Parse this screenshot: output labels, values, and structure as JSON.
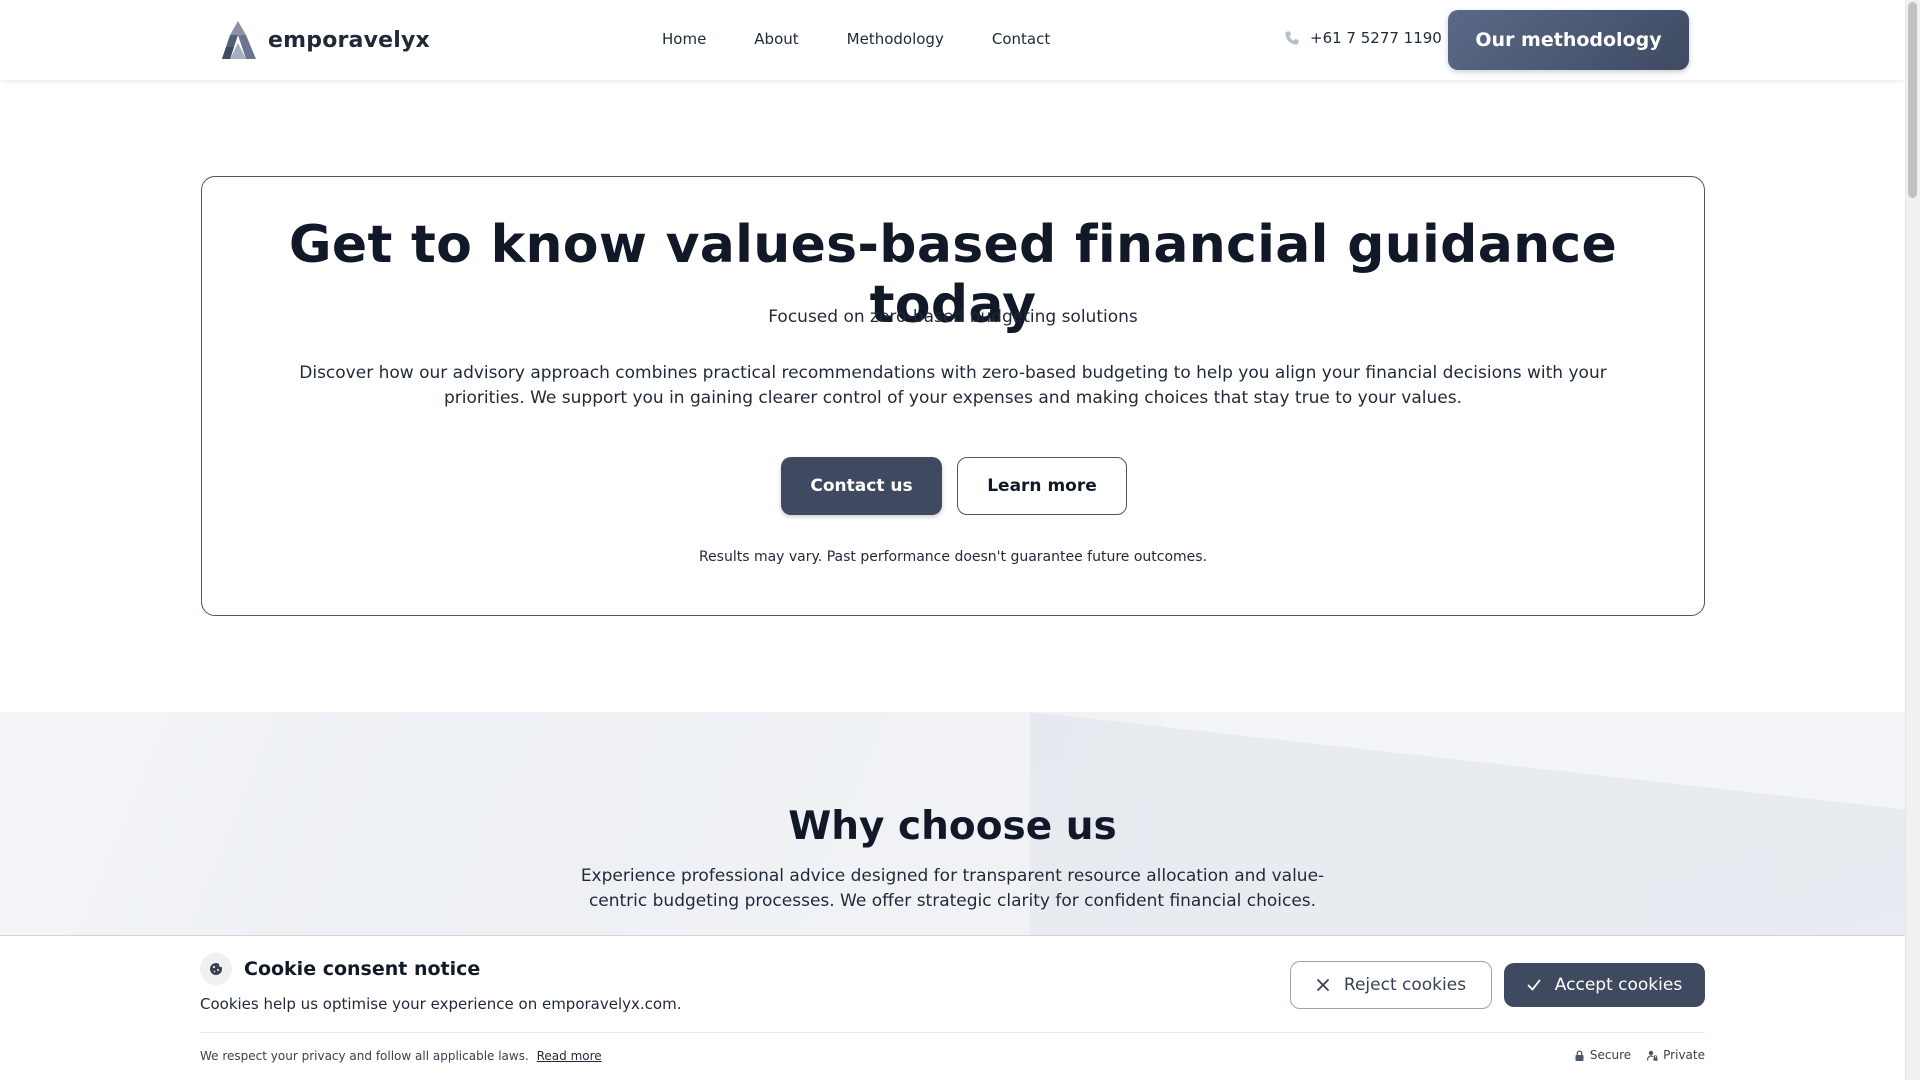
{
  "header": {
    "brand": "emporavelyx",
    "nav": [
      {
        "label": "Home"
      },
      {
        "label": "About"
      },
      {
        "label": "Methodology"
      },
      {
        "label": "Contact"
      }
    ],
    "phone": "+61 7 5277 1190",
    "cta_label": "Our methodology"
  },
  "hero": {
    "title": "Get to know values-based financial guidance today",
    "subtitle": "Focused on zero-based budgeting solutions",
    "description": "Discover how our advisory approach combines practical recommendations with zero-based budgeting to help you align your financial decisions with your priorities. We support you in gaining clearer control of your expenses and making choices that stay true to your values.",
    "primary_button": "Contact us",
    "secondary_button": "Learn more",
    "disclaimer": "Results may vary. Past performance doesn't guarantee future outcomes."
  },
  "why": {
    "title": "Why choose us",
    "description": "Experience professional advice designed for transparent resource allocation and value-centric budgeting processes. We offer strategic clarity for confident financial choices."
  },
  "cookie": {
    "title": "Cookie consent notice",
    "text": "Cookies help us optimise your experience on emporavelyx.com.",
    "reject_label": "Reject cookies",
    "accept_label": "Accept cookies",
    "privacy_text": "We respect your privacy and follow all applicable laws.",
    "read_more": "Read more",
    "flag_secure": "Secure",
    "flag_private": "Private"
  },
  "icons": {
    "logo": "logo-icon",
    "phone": "phone-icon",
    "cookie": "cookie-icon",
    "reject": "close-icon",
    "accept": "check-icon",
    "secure": "lock-icon",
    "private": "user-lock-icon"
  },
  "colors": {
    "primary_button": "#3f4a60",
    "text": "#111827",
    "section_bg": "#f3f5f8"
  }
}
